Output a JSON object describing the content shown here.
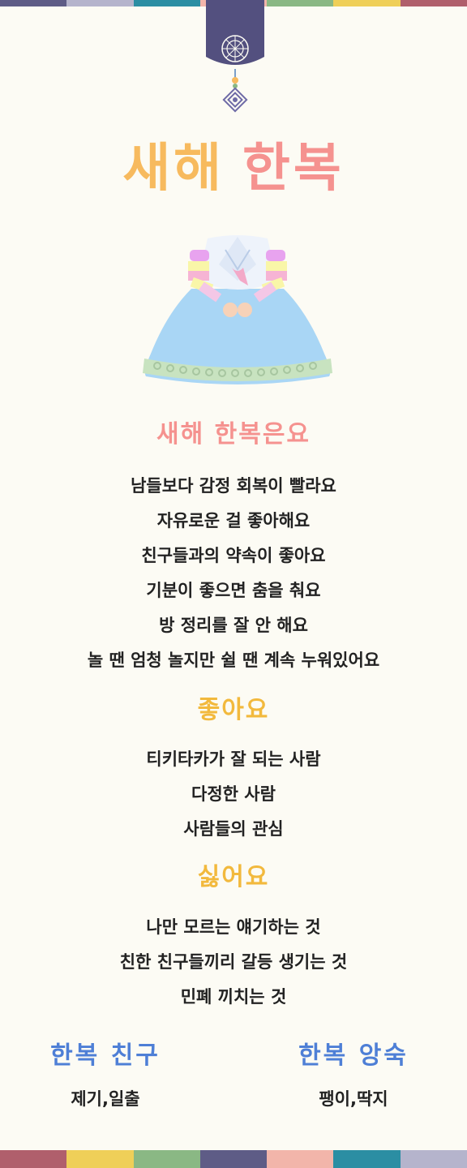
{
  "colors": {
    "background": "#fcfbf4",
    "title_first": "#f7ba5e",
    "title_second": "#f5928f",
    "section_intro": "#f5928f",
    "section_like": "#f2b93d",
    "section_dislike": "#f2b93d",
    "friend_titles": "#4e7fd6",
    "stripe": [
      "#5e5c86",
      "#b5b4cc",
      "#2b8ea3",
      "#f2b5aa",
      "#8ab884",
      "#efcf58",
      "#b05f6c"
    ]
  },
  "title": {
    "first": "새해",
    "second": "한복"
  },
  "sections": [
    {
      "title": "새해 한복은요",
      "lines": [
        "남들보다 감정 회복이 빨라요",
        "자유로운 걸 좋아해요",
        "친구들과의 약속이 좋아요",
        "기분이 좋으면 춤을 춰요",
        "방 정리를 잘 안 해요",
        "놀 땐 엄청 놀지만 쉴 땐 계속 누워있어요"
      ]
    },
    {
      "title": "좋아요",
      "lines": [
        "티키타카가 잘 되는 사람",
        "다정한 사람",
        "사람들의 관심"
      ]
    },
    {
      "title": "싫어요",
      "lines": [
        "나만 모르는 얘기하는 것",
        "친한 친구들끼리 갈등 생기는 것",
        "민폐 끼치는 것"
      ]
    }
  ],
  "friends": [
    {
      "title": "한복 친구",
      "value": "제기,일출"
    },
    {
      "title": "한복 앙숙",
      "value": "팽이,딱지"
    }
  ],
  "icons": [
    "banner-knot-icon",
    "hanbok-illustration"
  ]
}
